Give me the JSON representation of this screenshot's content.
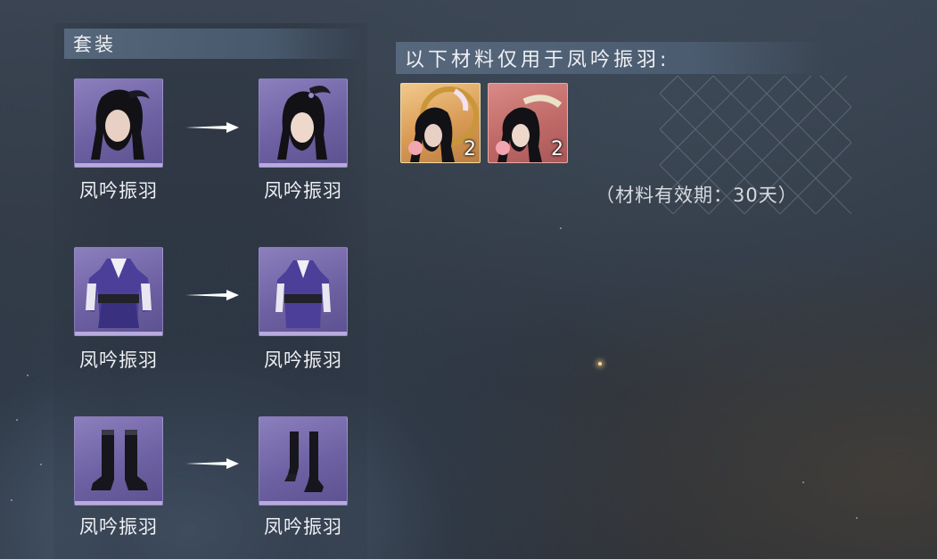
{
  "suit_panel": {
    "title": "套装",
    "rows": [
      {
        "from_label": "凤吟振羽",
        "to_label": "凤吟振羽",
        "slot_icon": "hairstyle-icon"
      },
      {
        "from_label": "凤吟振羽",
        "to_label": "凤吟振羽",
        "slot_icon": "outfit-icon"
      },
      {
        "from_label": "凤吟振羽",
        "to_label": "凤吟振羽",
        "slot_icon": "boots-icon"
      }
    ]
  },
  "materials_panel": {
    "title": "以下材料仅用于凤吟振羽:",
    "items": [
      {
        "rarity_color": "#e0a865",
        "count": "2",
        "icon": "hair-token-icon"
      },
      {
        "rarity_color": "#c47270",
        "count": "2",
        "icon": "hair-token-icon"
      }
    ],
    "validity": "（材料有效期：30天）"
  },
  "colors": {
    "slot_purple": "#7467a8",
    "header_bar": "#5c6e84"
  }
}
